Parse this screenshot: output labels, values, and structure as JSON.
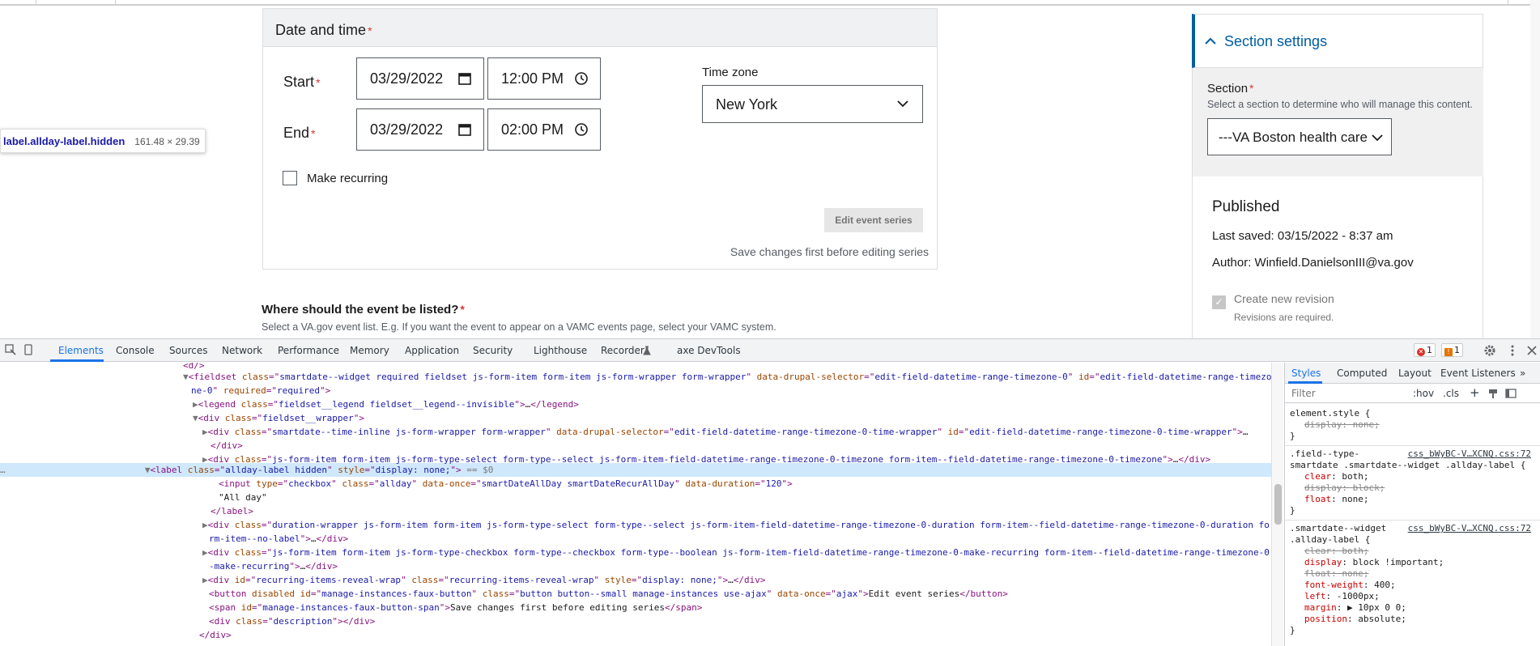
{
  "inspector_tooltip": {
    "selector": "label.allday-label.hidden",
    "size": "161.48 × 29.39"
  },
  "date_time": {
    "title": "Date and time",
    "required_mark": "*",
    "start_label": "Start",
    "end_label": "End",
    "start_date": "03/29/2022",
    "start_time": "12:00 PM",
    "end_date": "03/29/2022",
    "end_time": "02:00 PM",
    "timezone_label": "Time zone",
    "timezone_value": "New York",
    "recurring_label": "Make recurring",
    "edit_series_label": "Edit event series",
    "save_first_text": "Save changes first before editing series"
  },
  "listing": {
    "label": "Where should the event be listed?",
    "description": "Select a VA.gov event list. E.g. If you want the event to appear on a VAMC events page, select your VAMC system."
  },
  "sidebar": {
    "section_settings": "Section settings",
    "section_label": "Section",
    "section_desc": "Select a section to determine who will manage this content.",
    "section_value": "---VA Boston health care",
    "published_title": "Published",
    "last_saved_label": "Last saved:",
    "last_saved_value": "03/15/2022 - 8:37 am",
    "author_label": "Author:",
    "author_value": "Winfield.DanielsonIII@va.gov",
    "create_revision_label": "Create new revision",
    "revision_note": "Revisions are required."
  },
  "devtools": {
    "tabs": [
      "Elements",
      "Console",
      "Sources",
      "Network",
      "Performance",
      "Memory",
      "Application",
      "Security",
      "Lighthouse",
      "Recorder",
      "axe DevTools"
    ],
    "error_count": "1",
    "warning_count": "1",
    "styles_tabs": [
      "Styles",
      "Computed",
      "Layout",
      "Event Listeners",
      "»"
    ],
    "filter_placeholder": "Filter",
    "filter_hov": ":hov",
    "filter_cls": ".cls",
    "filter_plus": "+",
    "source_link_1": "css_bWyBC-V…XCNQ.css:72",
    "source_link_2": "css_bWyBC-V…XCNQ.css:72"
  },
  "colors": {
    "accent": "#005ea2",
    "required": "#d83933",
    "devtools_selected": "#cfe8fc",
    "devtools_accent": "#1a73e8"
  }
}
